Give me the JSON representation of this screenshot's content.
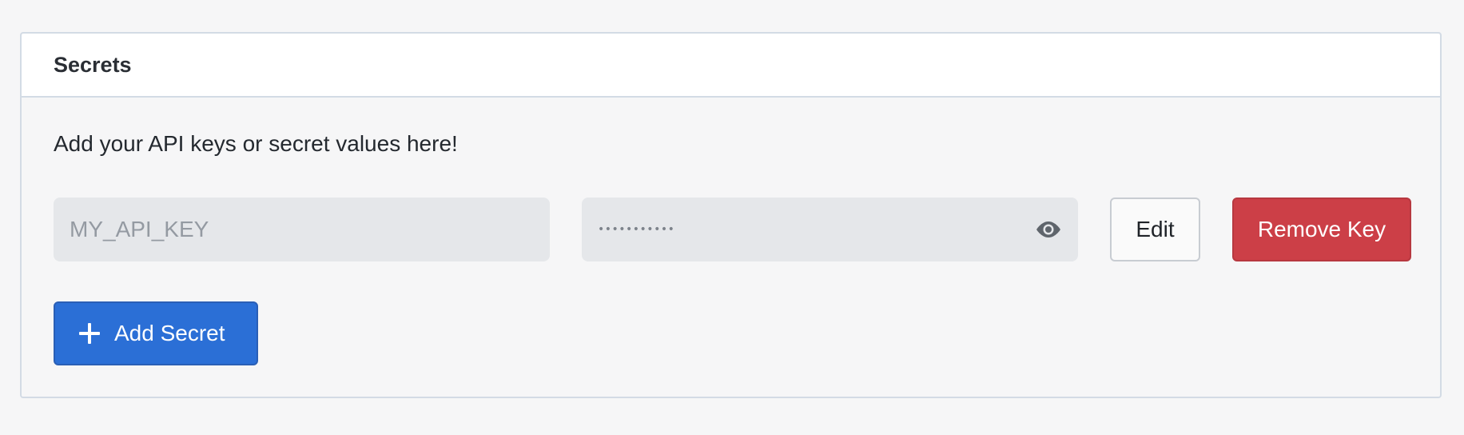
{
  "panel": {
    "title": "Secrets",
    "description": "Add your API keys or secret values here!"
  },
  "secrets": [
    {
      "key_placeholder": "MY_API_KEY",
      "value_masked": "•••••••••••",
      "visibility_icon": "eye-icon"
    }
  ],
  "actions": {
    "edit_label": "Edit",
    "remove_label": "Remove Key",
    "add_label": "Add Secret",
    "add_icon": "plus-icon"
  },
  "colors": {
    "primary": "#2b6fd6",
    "danger": "#cc3f47",
    "input_bg": "#e5e7ea",
    "border": "#d3dbe5"
  }
}
